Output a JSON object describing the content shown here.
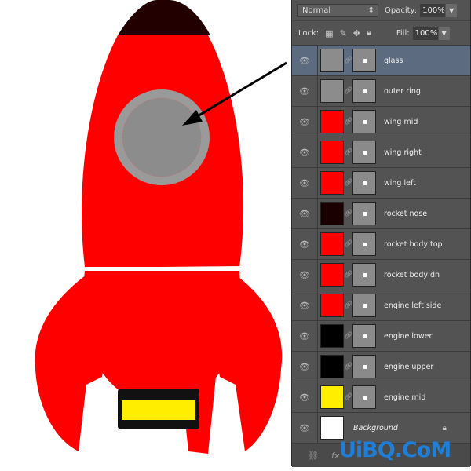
{
  "blend_mode": "Normal",
  "opacity_label": "Opacity:",
  "opacity": "100%",
  "lock_label": "Lock:",
  "fill_label": "Fill:",
  "fill": "100%",
  "layers": [
    {
      "name": "glass",
      "color": "#8c8c8c",
      "active": true
    },
    {
      "name": "outer ring",
      "color": "#8c8c8c"
    },
    {
      "name": "wing mid",
      "color": "#ff0000"
    },
    {
      "name": "wing right",
      "color": "#ff0000"
    },
    {
      "name": "wing left",
      "color": "#ff0000"
    },
    {
      "name": "rocket nose",
      "color": "#1a0000"
    },
    {
      "name": "rocket body top",
      "color": "#ff0000"
    },
    {
      "name": "rocket body dn",
      "color": "#ff0000"
    },
    {
      "name": "engine left side",
      "color": "#ff0000"
    },
    {
      "name": "engine lower",
      "color": "#000000"
    },
    {
      "name": "engine upper",
      "color": "#000000"
    },
    {
      "name": "engine mid",
      "color": "#ffee00"
    },
    {
      "name": "Background",
      "color": "#ffffff"
    }
  ],
  "watermark": "UiBQ.CoM",
  "colors": {
    "rocket": "#ff0000",
    "nose": "#220000",
    "glass": "#8c8c8c",
    "engine": "#ffee00"
  }
}
